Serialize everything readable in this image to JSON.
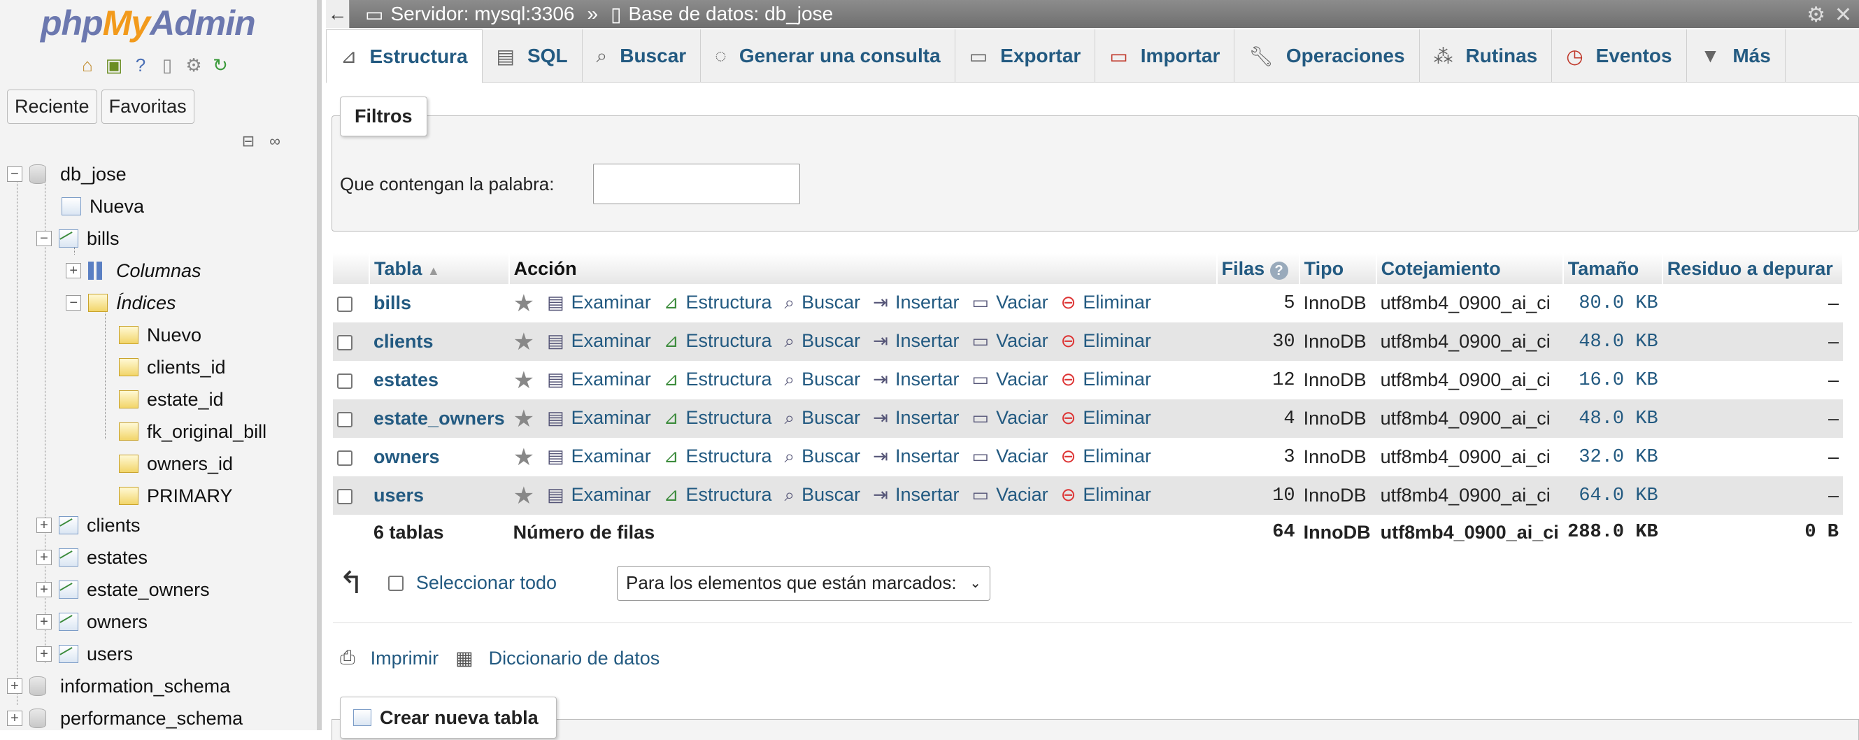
{
  "sidebar": {
    "logo": {
      "php": "php",
      "my": "My",
      "admin": "Admin"
    },
    "icons": [
      "home-icon",
      "exit-icon",
      "help-icon",
      "docs-icon",
      "settings-icon",
      "reload-icon"
    ],
    "nav_buttons": [
      "Reciente",
      "Favoritas"
    ],
    "tree": {
      "db_jose": "db_jose",
      "nueva": "Nueva",
      "bills": "bills",
      "columnas": "Columnas",
      "indices": "Índices",
      "nuevo": "Nuevo",
      "indexes": [
        "clients_id",
        "estate_id",
        "fk_original_bill",
        "owners_id",
        "PRIMARY"
      ],
      "other_tables": [
        "clients",
        "estates",
        "estate_owners",
        "owners",
        "users"
      ],
      "other_dbs": [
        "information_schema",
        "performance_schema"
      ]
    }
  },
  "topbar": {
    "server": "Servidor: mysql:3306",
    "separator": "»",
    "database": "Base de datos: db_jose"
  },
  "tabs": [
    {
      "label": "Estructura",
      "icon": "structure-icon"
    },
    {
      "label": "SQL",
      "icon": "sql-icon"
    },
    {
      "label": "Buscar",
      "icon": "search-icon"
    },
    {
      "label": "Generar una consulta",
      "icon": "query-icon"
    },
    {
      "label": "Exportar",
      "icon": "export-icon"
    },
    {
      "label": "Importar",
      "icon": "import-icon"
    },
    {
      "label": "Operaciones",
      "icon": "wrench-icon"
    },
    {
      "label": "Rutinas",
      "icon": "routines-icon"
    },
    {
      "label": "Eventos",
      "icon": "clock-icon"
    },
    {
      "label": "Más",
      "icon": "chevron-down-icon"
    }
  ],
  "filters": {
    "legend": "Filtros",
    "label": "Que contengan la palabra:",
    "value": ""
  },
  "table": {
    "headers": {
      "tabla": "Tabla",
      "accion": "Acción",
      "filas": "Filas",
      "tipo": "Tipo",
      "cotejamiento": "Cotejamiento",
      "tamano": "Tamaño",
      "residuo": "Residuo a depurar"
    },
    "actions": [
      "Examinar",
      "Estructura",
      "Buscar",
      "Insertar",
      "Vaciar",
      "Eliminar"
    ],
    "rows": [
      {
        "name": "bills",
        "rows": "5",
        "type": "InnoDB",
        "collation": "utf8mb4_0900_ai_ci",
        "size": "80.0",
        "unit": "KB",
        "overhead": "–"
      },
      {
        "name": "clients",
        "rows": "30",
        "type": "InnoDB",
        "collation": "utf8mb4_0900_ai_ci",
        "size": "48.0",
        "unit": "KB",
        "overhead": "–"
      },
      {
        "name": "estates",
        "rows": "12",
        "type": "InnoDB",
        "collation": "utf8mb4_0900_ai_ci",
        "size": "16.0",
        "unit": "KB",
        "overhead": "–"
      },
      {
        "name": "estate_owners",
        "rows": "4",
        "type": "InnoDB",
        "collation": "utf8mb4_0900_ai_ci",
        "size": "48.0",
        "unit": "KB",
        "overhead": "–"
      },
      {
        "name": "owners",
        "rows": "3",
        "type": "InnoDB",
        "collation": "utf8mb4_0900_ai_ci",
        "size": "32.0",
        "unit": "KB",
        "overhead": "–"
      },
      {
        "name": "users",
        "rows": "10",
        "type": "InnoDB",
        "collation": "utf8mb4_0900_ai_ci",
        "size": "64.0",
        "unit": "KB",
        "overhead": "–"
      }
    ],
    "footer": {
      "count": "6 tablas",
      "label": "Número de filas",
      "rows": "64",
      "type": "InnoDB",
      "collation": "utf8mb4_0900_ai_ci",
      "size": "288.0",
      "unit": "KB",
      "overhead": "0",
      "overhead_unit": "B"
    }
  },
  "bulk": {
    "select_all": "Seleccionar todo",
    "with_selected": "Para los elementos que están marcados:"
  },
  "links": {
    "print": "Imprimir",
    "dictionary": "Diccionario de datos"
  },
  "create_table": "Crear nueva tabla"
}
